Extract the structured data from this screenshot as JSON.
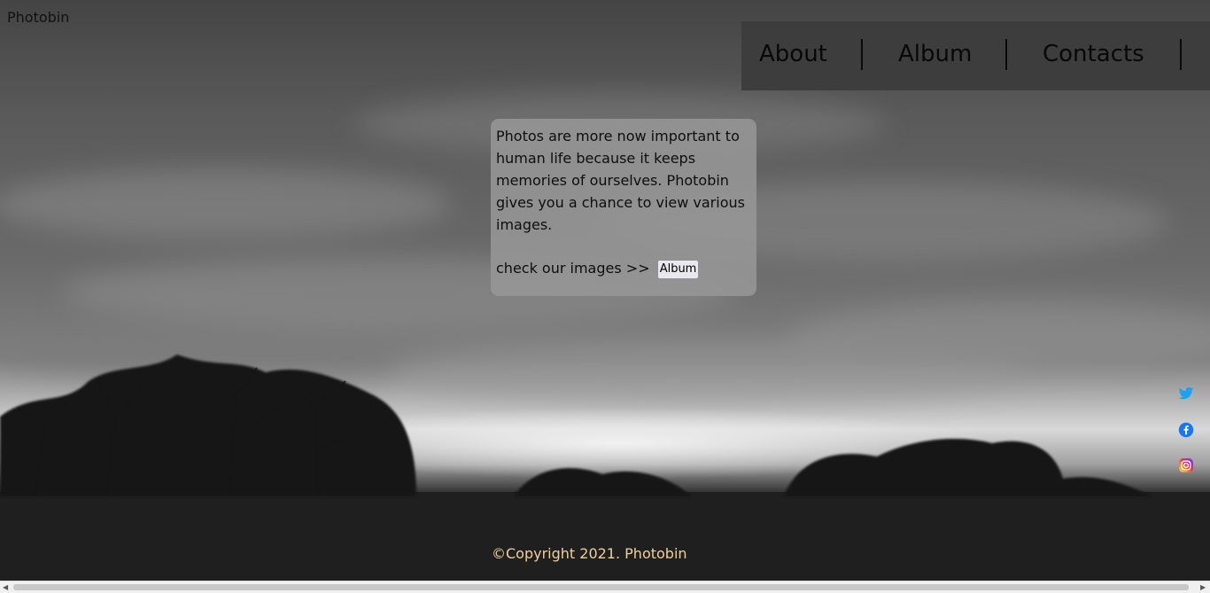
{
  "header": {
    "logo": "Photobin"
  },
  "nav": {
    "items": [
      {
        "label": "About"
      },
      {
        "label": "Album"
      },
      {
        "label": "Contacts"
      }
    ]
  },
  "intro": {
    "text": "Photos are more now important to human life because it keeps memories of ourselves. Photobin gives you a chance to view various images.",
    "check_label": "check our images >>",
    "album_button": "Album"
  },
  "social": {
    "icons": [
      "twitter-icon",
      "facebook-icon",
      "instagram-icon"
    ]
  },
  "footer": {
    "copyright": "©Copyright 2021. Photobin"
  },
  "colors": {
    "footer_text": "#f0cf9f",
    "nav_background": "#3c3c3c",
    "infobox_background": "#969696",
    "twitter": "#1da1f2",
    "facebook": "#1877f2"
  }
}
